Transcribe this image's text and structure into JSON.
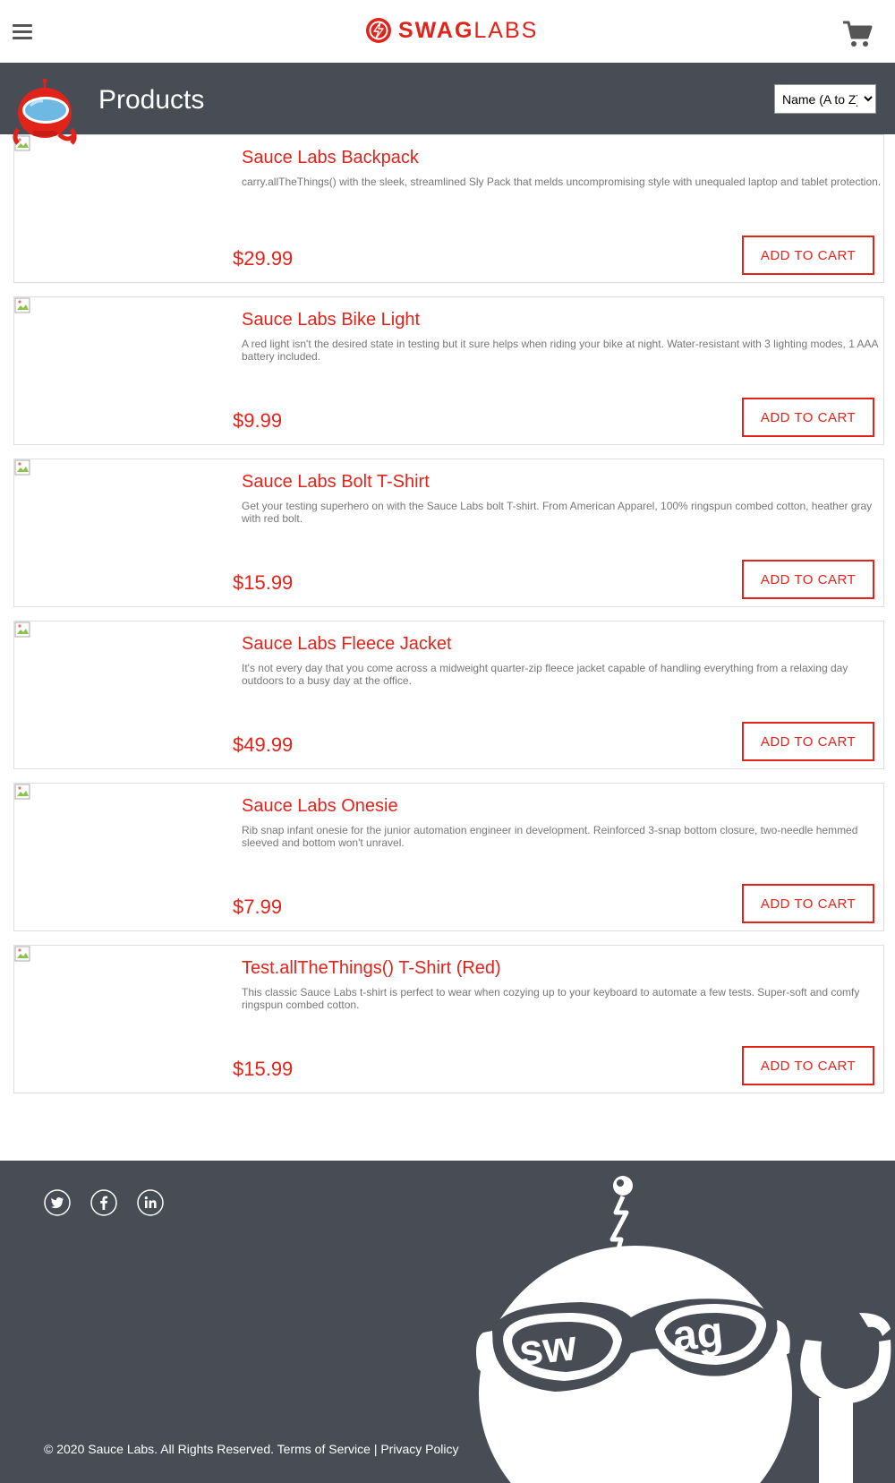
{
  "header": {
    "logo_bold": "SWAG",
    "logo_light": "LABS",
    "accent": "#e2231a"
  },
  "subheader": {
    "title": "Products",
    "sort_selected": "Name (A to Z)",
    "bg": "#474c55"
  },
  "items": [
    {
      "name": "Sauce Labs Backpack",
      "desc": "carry.allTheThings() with the sleek, streamlined Sly Pack that melds uncompromising style with unequaled laptop and tablet protection.",
      "price": "$29.99",
      "button": "ADD TO CART"
    },
    {
      "name": "Sauce Labs Bike Light",
      "desc": "A red light isn't the desired state in testing but it sure helps when riding your bike at night. Water-resistant with 3 lighting modes, 1 AAA battery included.",
      "price": "$9.99",
      "button": "ADD TO CART"
    },
    {
      "name": "Sauce Labs Bolt T-Shirt",
      "desc": "Get your testing superhero on with the Sauce Labs bolt T-shirt. From American Apparel, 100% ringspun combed cotton, heather gray with red bolt.",
      "price": "$15.99",
      "button": "ADD TO CART"
    },
    {
      "name": "Sauce Labs Fleece Jacket",
      "desc": "It's not every day that you come across a midweight quarter-zip fleece jacket capable of handling everything from a relaxing day outdoors to a busy day at the office.",
      "price": "$49.99",
      "button": "ADD TO CART"
    },
    {
      "name": "Sauce Labs Onesie",
      "desc": "Rib snap infant onesie for the junior automation engineer in development. Reinforced 3-snap bottom closure, two-needle hemmed sleeved and bottom won't unravel.",
      "price": "$7.99",
      "button": "ADD TO CART"
    },
    {
      "name": "Test.allTheThings() T-Shirt (Red)",
      "desc": "This classic Sauce Labs t-shirt is perfect to wear when cozying up to your keyboard to automate a few tests. Super-soft and comfy ringspun combed cotton.",
      "price": "$15.99",
      "button": "ADD TO CART"
    }
  ],
  "footer": {
    "copy": "© 2020 Sauce Labs. All Rights Reserved.",
    "terms": "Terms of Service",
    "separator": "|",
    "privacy": "Privacy Policy",
    "social": [
      "twitter-icon",
      "facebook-icon",
      "linkedin-icon"
    ],
    "robot_glasses_left": "sw",
    "robot_glasses_right": "ag"
  }
}
